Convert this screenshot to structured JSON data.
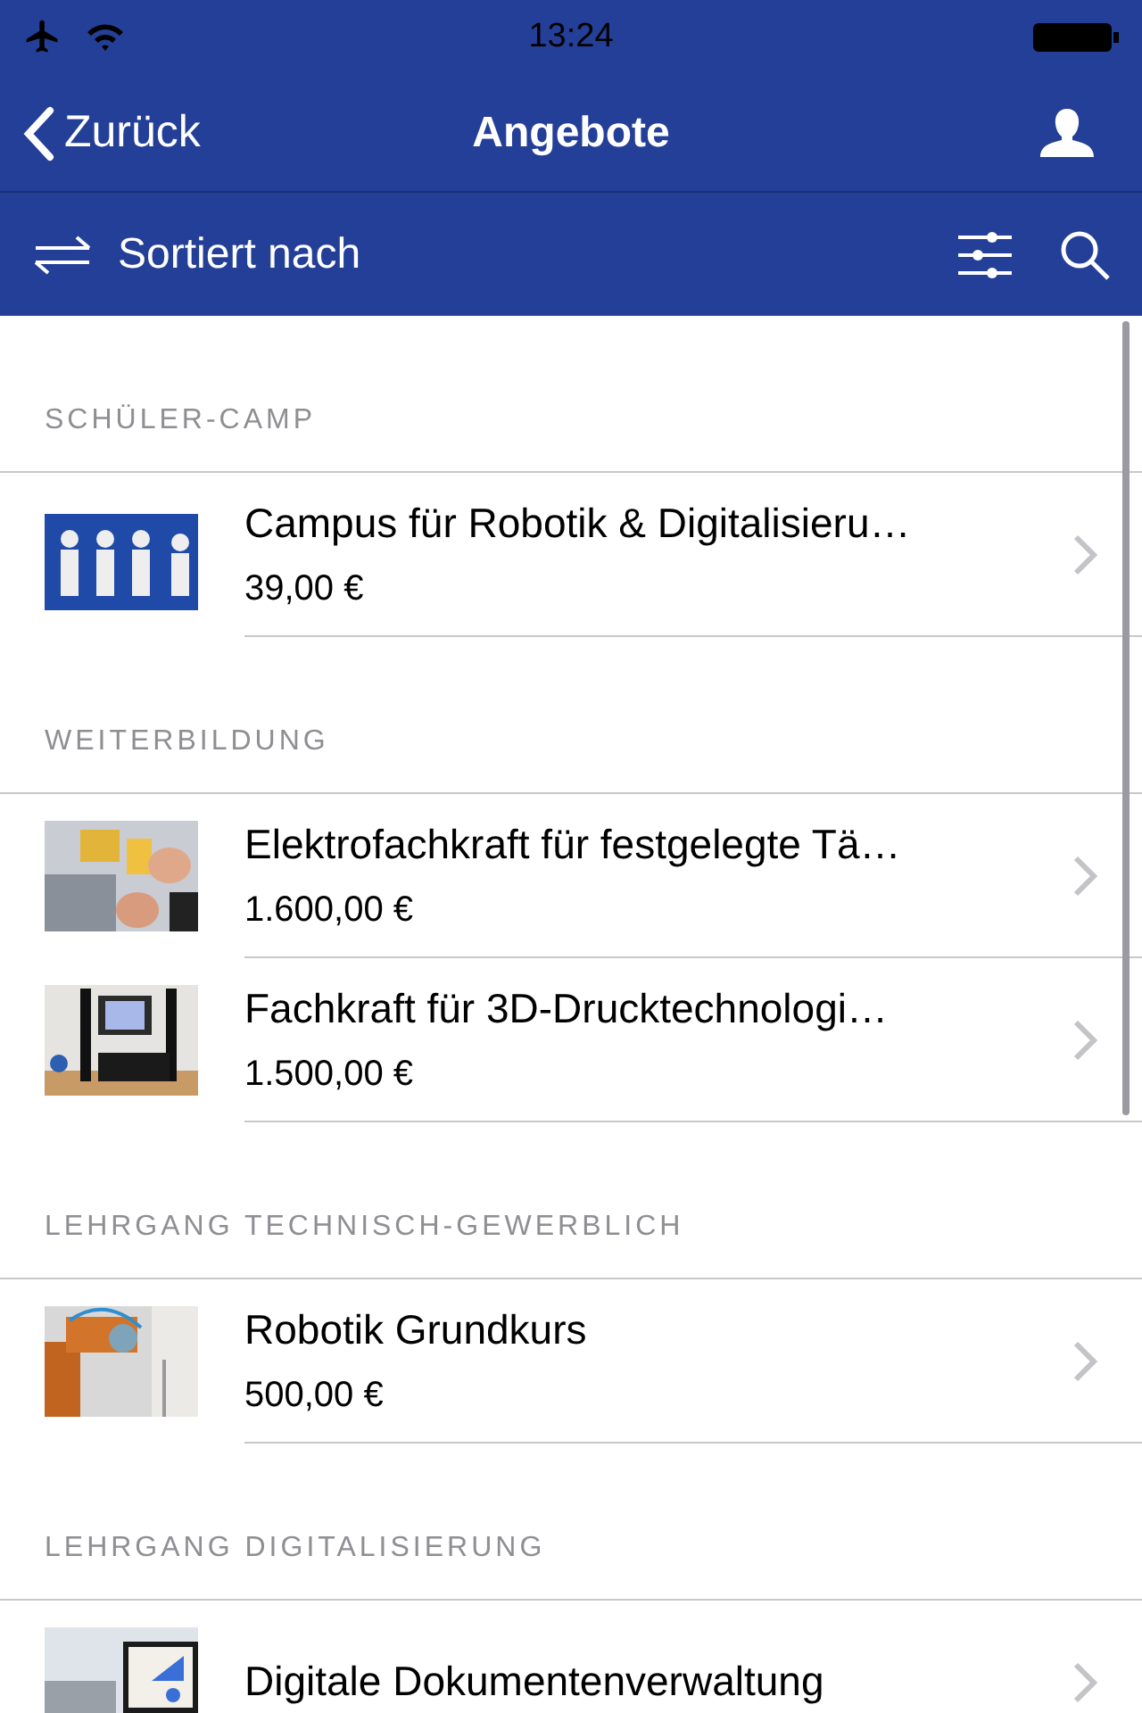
{
  "status_bar": {
    "time": "13:24"
  },
  "nav_bar": {
    "back": "Zurück",
    "title": "Angebote"
  },
  "toolbar": {
    "sort": "Sortiert nach"
  },
  "sections": [
    {
      "title": "SCHÜLER-CAMP",
      "items": [
        {
          "title": "Campus für Robotik & Digitalisieru…",
          "price": "39,00 €",
          "kind": "picture"
        }
      ]
    },
    {
      "title": "WEITERBILDUNG",
      "items": [
        {
          "title": "Elektrofachkraft für festgelegte Tä…",
          "price": "1.600,00 €",
          "kind": "picture"
        },
        {
          "title": "Fachkraft für 3D-Drucktechnologi…",
          "price": "1.500,00 €",
          "kind": "picture"
        }
      ]
    },
    {
      "title": "LEHRGANG TECHNISCH-GEWERBLICH",
      "items": [
        {
          "title": "Robotik Grundkurs",
          "price": "500,00 €",
          "kind": "picture"
        }
      ]
    },
    {
      "title": "LEHRGANG DIGITALISIERUNG",
      "items": [
        {
          "title": "Digitale Dokumentenverwaltung",
          "kind": "picture"
        }
      ]
    }
  ]
}
